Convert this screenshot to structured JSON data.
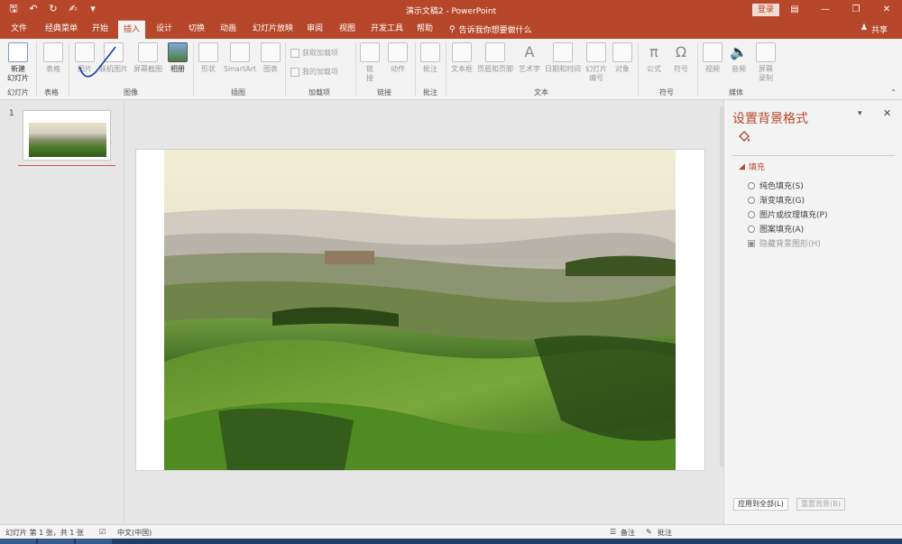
{
  "title_bar": {
    "title": "演示文稿2 - PowerPoint",
    "login": "登录",
    "qat_icons": [
      "save-icon",
      "undo-icon",
      "redo-icon",
      "touch-mode-icon",
      "customize-icon"
    ]
  },
  "tabs": [
    {
      "label": "文件"
    },
    {
      "label": "经典菜单"
    },
    {
      "label": "开始"
    },
    {
      "label": "插入",
      "active": true
    },
    {
      "label": "设计"
    },
    {
      "label": "切换"
    },
    {
      "label": "动画"
    },
    {
      "label": "幻灯片放映"
    },
    {
      "label": "审阅"
    },
    {
      "label": "视图"
    },
    {
      "label": "开发工具"
    },
    {
      "label": "帮助"
    }
  ],
  "tell_me": "告诉我你想要做什么",
  "share": "共享",
  "ribbon": {
    "new_slide": "新建\n幻灯片",
    "table": "表格",
    "image": "图片",
    "online_image": "联机图片",
    "screenshot": "屏幕截图",
    "album": "相册",
    "shape": "形状",
    "smartart": "SmartArt",
    "chart": "图表",
    "get_addins": "获取加载项",
    "my_addins": "我的加载项",
    "link": "链\n接",
    "action": "动作",
    "comment": "批注",
    "textbox": "文本框",
    "header_footer": "页眉和页脚",
    "wordart": "艺术字",
    "datetime": "日期和时间",
    "slide_number": "幻灯片\n编号",
    "object": "对象",
    "equation": "公式",
    "symbol": "符号",
    "video": "视频",
    "audio": "音频",
    "screen_recording": "屏幕\n录制",
    "groups": {
      "slides": "幻灯片",
      "tables": "表格",
      "images": "图像",
      "illustrations": "插图",
      "addins": "加载项",
      "links": "链接",
      "comments": "批注",
      "text": "文本",
      "symbols": "符号",
      "media": "媒体"
    }
  },
  "slides_pane": {
    "slide_number": "1"
  },
  "format_pane": {
    "title": "设置背景格式",
    "section": "填充",
    "options": {
      "solid": "纯色填充(S)",
      "gradient": "渐变填充(G)",
      "picture": "图片或纹理填充(P)",
      "pattern": "图案填充(A)",
      "hide_graphics": "隐藏背景图形(H)"
    },
    "apply_all": "应用到全部(L)",
    "reset": "重置背景(B)"
  },
  "status_bar": {
    "slide_info": "幻灯片 第 1 张，共 1 张",
    "language": "中文(中国)",
    "notes": "备注",
    "comments": "批注"
  },
  "colors": {
    "accent": "#b7472a",
    "ribbon_bg": "#f3f3f3"
  }
}
